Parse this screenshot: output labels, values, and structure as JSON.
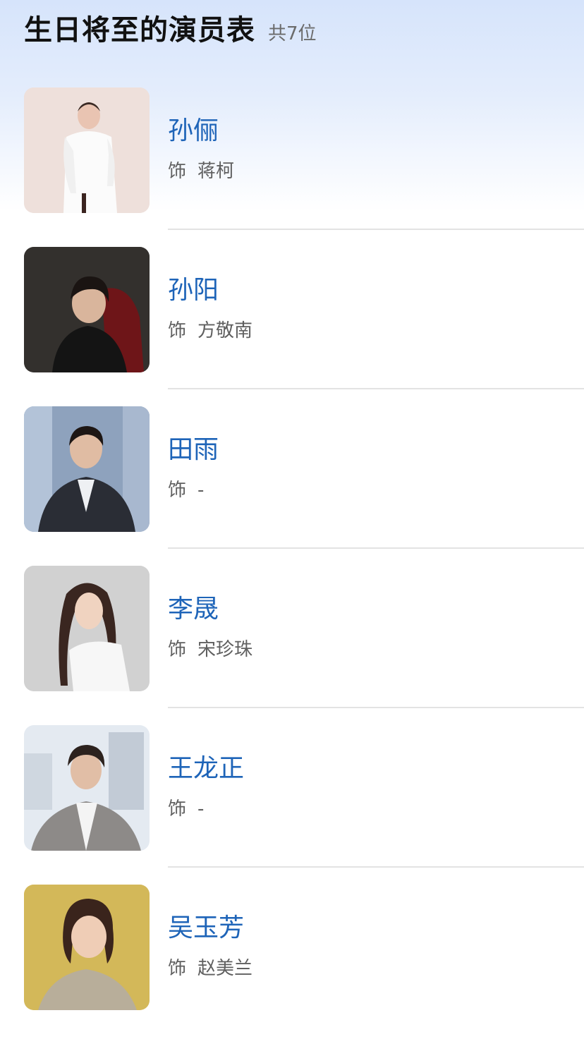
{
  "header": {
    "title": "生日将至的演员表",
    "count": "共7位"
  },
  "role_prefix": "饰",
  "actors": [
    {
      "name": "孙俪",
      "role": "蒋柯"
    },
    {
      "name": "孙阳",
      "role": "方敬南"
    },
    {
      "name": "田雨",
      "role": "-"
    },
    {
      "name": "李晟",
      "role": "宋珍珠"
    },
    {
      "name": "王龙正",
      "role": "-"
    },
    {
      "name": "吴玉芳",
      "role": "赵美兰"
    }
  ],
  "colors": {
    "name_link": "#1e64b8",
    "role_text": "#5f5f5f",
    "title_text": "#111111",
    "header_gradient_top": "#d6e4fb"
  }
}
